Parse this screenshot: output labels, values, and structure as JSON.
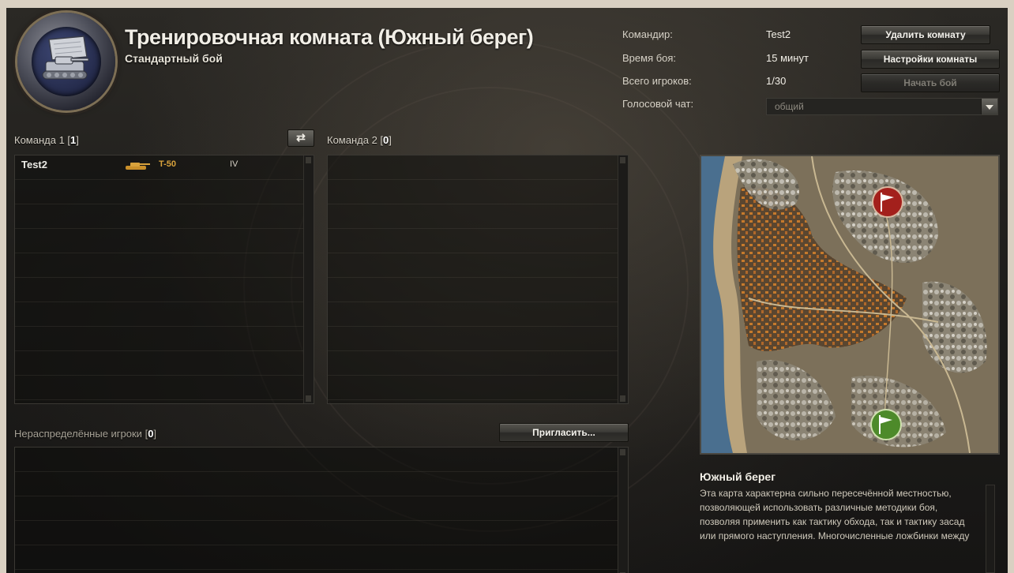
{
  "room": {
    "title": "Тренировочная комната (Южный берег)",
    "subtitle": "Стандартный бой"
  },
  "info": {
    "commander_label": "Командир:",
    "commander_value": "Test2",
    "battle_time_label": "Время боя:",
    "battle_time_value": "15 минут",
    "players_label": "Всего игроков:",
    "players_value": "1/30",
    "voice_chat_label": "Голосовой чат:",
    "voice_chat_value": "общий"
  },
  "buttons": {
    "delete_room": "Удалить комнату",
    "room_settings": "Настройки комнаты",
    "start_battle": "Начать бой",
    "invite": "Пригласить...",
    "swap_teams_icon": "swap-arrows-icon"
  },
  "team1": {
    "label": "Команда 1",
    "count": "1",
    "players": [
      {
        "name": "Test2",
        "tank": "T-50",
        "tier": "IV",
        "tank_icon": "light-tank-icon"
      }
    ]
  },
  "team2": {
    "label": "Команда 2",
    "count": "0",
    "players": []
  },
  "unassigned": {
    "label": "Нераспределённые игроки",
    "count": "0"
  },
  "map": {
    "name": "Южный берег",
    "description": "Эта карта характерна сильно пересечённой местностью, позволяющей использовать различные методики боя, позволяя применить как тактику обхода, так и тактику засад или прямого наступления. Многочисленные ложбинки между",
    "base_red_icon": "red-flag-base-icon",
    "base_green_icon": "green-flag-base-icon"
  },
  "colors": {
    "tank_name": "#d8a23c",
    "red_base": "#a3201c",
    "green_base": "#4d8a2a",
    "water": "#4a6f8f"
  }
}
